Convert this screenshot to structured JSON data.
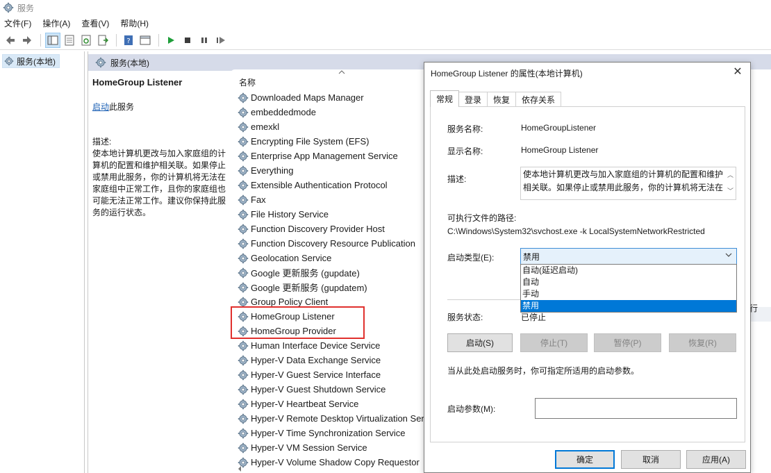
{
  "window": {
    "title": "服务"
  },
  "menu": [
    "文件(F)",
    "操作(A)",
    "查看(V)",
    "帮助(H)"
  ],
  "tree": {
    "item": "服务(本地)"
  },
  "main": {
    "header": "服务(本地)",
    "detail": {
      "title": "HomeGroup Listener",
      "start_link": "启动",
      "start_suffix": "此服务",
      "desc_label": "描述:",
      "desc_text": "使本地计算机更改与加入家庭组的计算机的配置和维护相关联。如果停止或禁用此服务，你的计算机将无法在家庭组中正常工作，且你的家庭组也可能无法正常工作。建议你保持此服务的运行状态。"
    },
    "column_name": "名称",
    "services": [
      "Downloaded Maps Manager",
      "embeddedmode",
      "emexkl",
      "Encrypting File System (EFS)",
      "Enterprise App Management Service",
      "Everything",
      "Extensible Authentication Protocol",
      "Fax",
      "File History Service",
      "Function Discovery Provider Host",
      "Function Discovery Resource Publication",
      "Geolocation Service",
      "Google 更新服务 (gupdate)",
      "Google 更新服务 (gupdatem)",
      "Group Policy Client",
      "HomeGroup Listener",
      "HomeGroup Provider",
      "Human Interface Device Service",
      "Hyper-V Data Exchange Service",
      "Hyper-V Guest Service Interface",
      "Hyper-V Guest Shutdown Service",
      "Hyper-V Heartbeat Service",
      "Hyper-V Remote Desktop Virtualization Ser",
      "Hyper-V Time Synchronization Service",
      "Hyper-V VM Session Service",
      "Hyper-V Volume Shadow Copy Requestor"
    ],
    "right_cut_text": "行"
  },
  "dialog": {
    "title": "HomeGroup Listener 的属性(本地计算机)",
    "tabs": [
      "常规",
      "登录",
      "恢复",
      "依存关系"
    ],
    "service_name_label": "服务名称:",
    "service_name": "HomeGroupListener",
    "display_name_label": "显示名称:",
    "display_name": "HomeGroup Listener",
    "description_label": "描述:",
    "description": "使本地计算机更改与加入家庭组的计算机的配置和维护相关联。如果停止或禁用此服务，你的计算机将无法在",
    "exe_path_label": "可执行文件的路径:",
    "exe_path": "C:\\Windows\\System32\\svchost.exe -k LocalSystemNetworkRestricted",
    "startup_type_label": "启动类型(E):",
    "startup_type": "禁用",
    "startup_options": [
      "自动(延迟启动)",
      "自动",
      "手动",
      "禁用"
    ],
    "status_label": "服务状态:",
    "status": "已停止",
    "buttons": {
      "start": "启动(S)",
      "stop": "停止(T)",
      "pause": "暂停(P)",
      "resume": "恢复(R)"
    },
    "hint": "当从此处启动服务时，你可指定所适用的启动参数。",
    "params_label": "启动参数(M):",
    "params_value": "",
    "footer": {
      "ok": "确定",
      "cancel": "取消",
      "apply": "应用(A)"
    }
  }
}
